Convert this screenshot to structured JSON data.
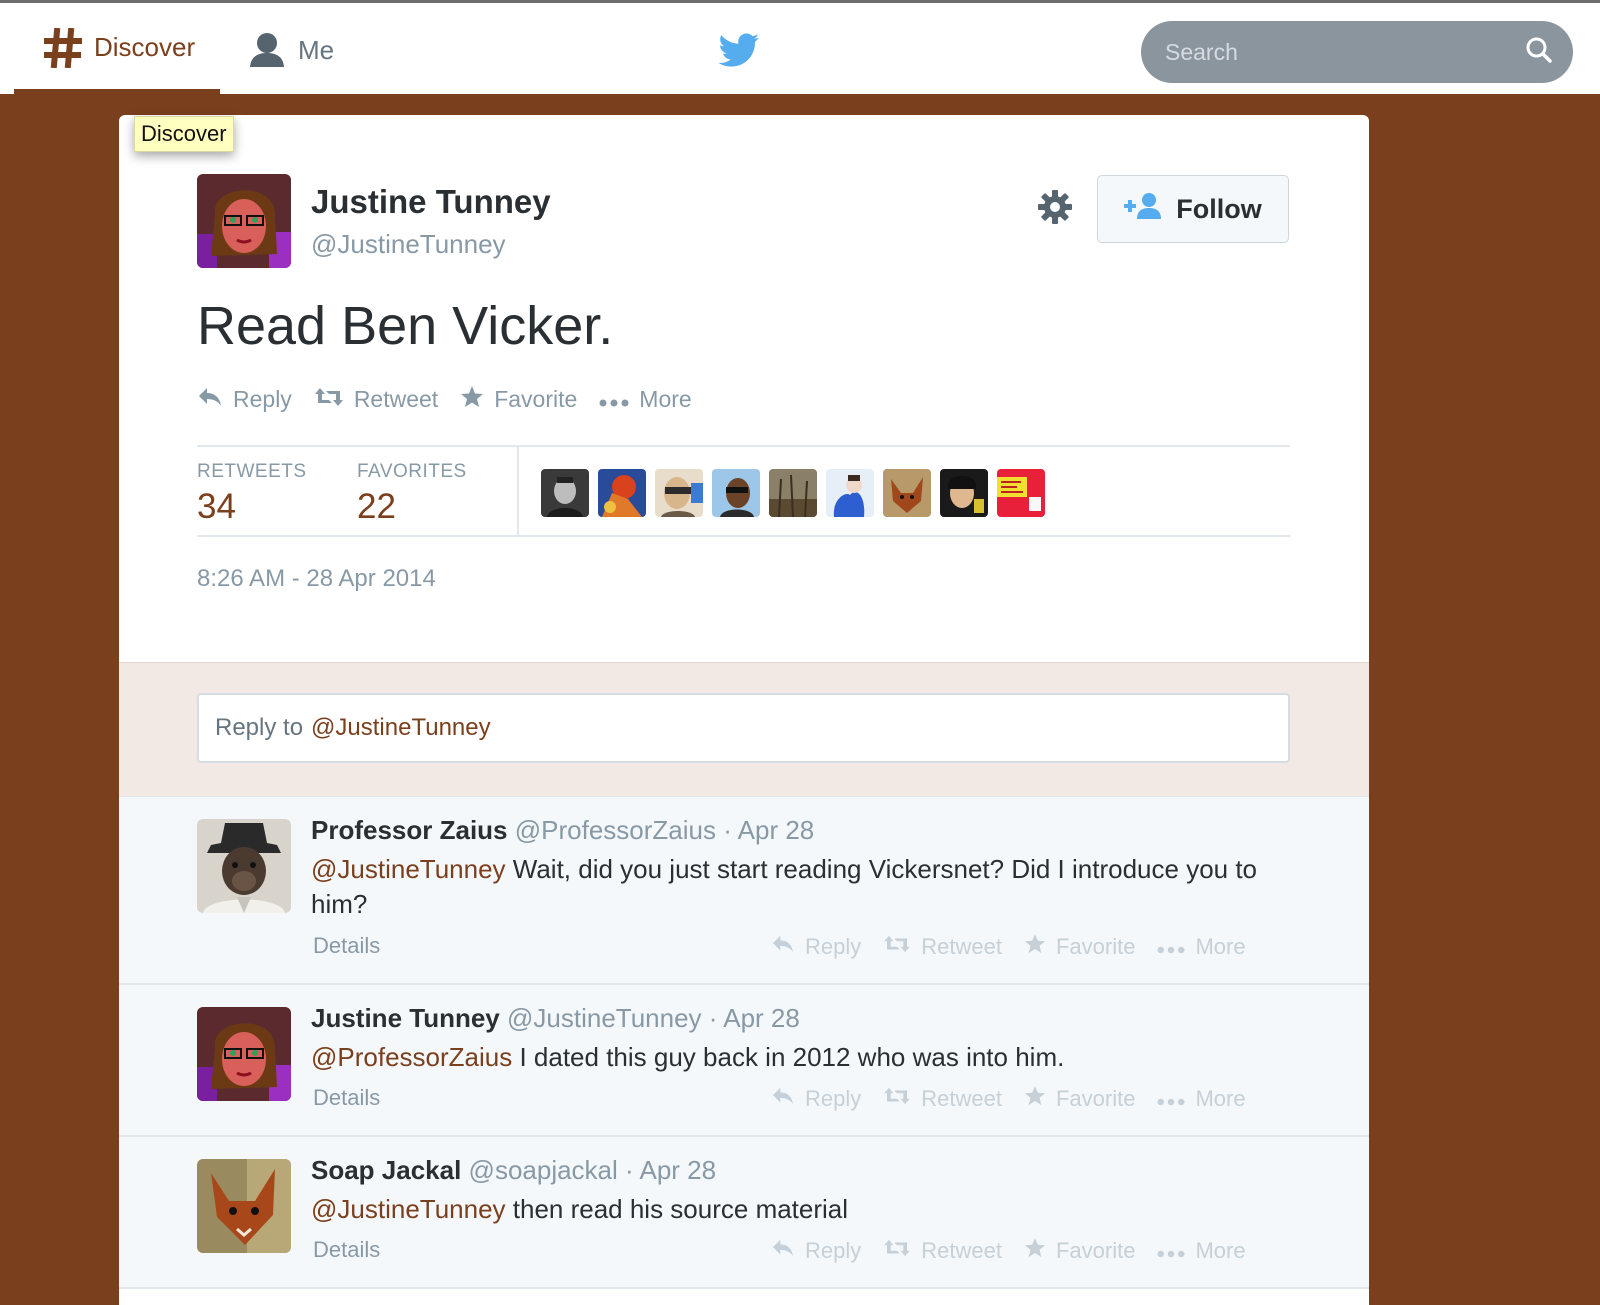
{
  "nav": {
    "discover_label": "Discover",
    "me_label": "Me",
    "search_placeholder": "Search"
  },
  "tooltip": {
    "text": "Discover"
  },
  "tweet": {
    "author_name": "Justine Tunney",
    "author_handle": "@JustineTunney",
    "text": "Read Ben Vicker.",
    "follow_label": "Follow",
    "actions": {
      "reply": "Reply",
      "retweet": "Retweet",
      "favorite": "Favorite",
      "more": "More"
    },
    "stats": {
      "retweets_label": "RETWEETS",
      "retweets_count": "34",
      "favorites_label": "FAVORITES",
      "favorites_count": "22"
    },
    "timestamp": "8:26 AM - 28 Apr 2014"
  },
  "reply_box": {
    "prefix": "Reply to",
    "mention": "@JustineTunney"
  },
  "replies": [
    {
      "name": "Professor Zaius",
      "handle": "@ProfessorZaius",
      "time": "· Apr 28",
      "mention": "@JustineTunney",
      "text": " Wait, did you just start reading Vickersnet? Did I introduce you to him?",
      "details": "Details"
    },
    {
      "name": "Justine Tunney",
      "handle": "@JustineTunney",
      "time": "· Apr 28",
      "mention": "@ProfessorZaius",
      "text": " I dated this guy back in 2012 who was into him.",
      "details": "Details"
    },
    {
      "name": "Soap Jackal",
      "handle": "@soapjackal",
      "time": "· Apr 28",
      "mention": "@JustineTunney",
      "text": " then read his source material",
      "details": "Details"
    }
  ],
  "colors": {
    "accent": "#7a3f1d",
    "muted_text": "#8899a6",
    "reply_bg": "#f2e8e4",
    "reply_item_bg": "#f5f8fa"
  }
}
